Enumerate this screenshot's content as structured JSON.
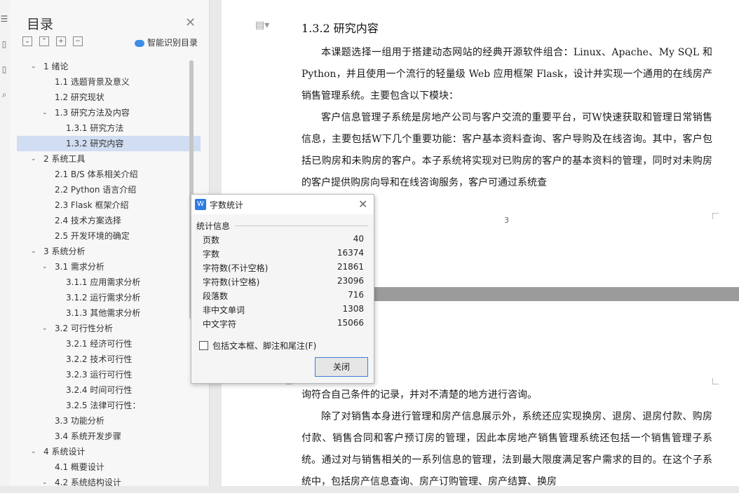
{
  "toc": {
    "title": "目录",
    "smart": "智能识别目录",
    "items": [
      {
        "label": "1 绪论",
        "level": 1,
        "arrow": "v"
      },
      {
        "label": "1.1 选题背景及意义",
        "level": 2
      },
      {
        "label": "1.2 研究现状",
        "level": 2
      },
      {
        "label": "1.3 研究方法及内容",
        "level": 2,
        "arrow": "v"
      },
      {
        "label": "1.3.1 研究方法",
        "level": 3
      },
      {
        "label": "1.3.2 研究内容",
        "level": 3,
        "active": true
      },
      {
        "label": "2 系统工具",
        "level": 1,
        "arrow": "v"
      },
      {
        "label": "2.1 B/S 体系相关介绍",
        "level": 2
      },
      {
        "label": "2.2 Python 语言介绍",
        "level": 2
      },
      {
        "label": "2.3 Flask 框架介绍",
        "level": 2
      },
      {
        "label": "2.4 技术方案选择",
        "level": 2
      },
      {
        "label": "2.5 开发环境的确定",
        "level": 2
      },
      {
        "label": "3 系统分析",
        "level": 1,
        "arrow": "v"
      },
      {
        "label": "3.1 需求分析",
        "level": 2,
        "arrow": "v"
      },
      {
        "label": "3.1.1 应用需求分析",
        "level": 3
      },
      {
        "label": "3.1.2 运行需求分析",
        "level": 3
      },
      {
        "label": "3.1.3 其他需求分析",
        "level": 3
      },
      {
        "label": "3.2 可行性分析",
        "level": 2,
        "arrow": "v"
      },
      {
        "label": "3.2.1 经济可行性",
        "level": 3
      },
      {
        "label": "3.2.2 技术可行性",
        "level": 3
      },
      {
        "label": "3.2.3 运行可行性",
        "level": 3
      },
      {
        "label": "3.2.4 时间可行性",
        "level": 3
      },
      {
        "label": "3.2.5 法律可行性：",
        "level": 3
      },
      {
        "label": "3.3 功能分析",
        "level": 2
      },
      {
        "label": "3.4 系统开发步骤",
        "level": 2
      },
      {
        "label": "4 系统设计",
        "level": 1,
        "arrow": "v"
      },
      {
        "label": "4.1 概要设计",
        "level": 2
      },
      {
        "label": "4.2 系统结构设计",
        "level": 2,
        "arrow": "v"
      }
    ]
  },
  "doc": {
    "heading": "1.3.2 研究内容",
    "p1": "本课题选择一组用于搭建动态网站的经典开源软件组合：Linux、Apache、My SQL 和 Python，并且使用一个流行的轻量级 Web 应用框架 Flask，设计并实现一个通用的在线房产销售管理系统。主要包含以下模块：",
    "p2": "客户信息管理子系统是房地产公司与客户交流的重要平台，可W快速获取和管理日常销售信息，主要包括W下几个重要功能：客户基本资料查询、客户导购及在线咨询。其中，客户包括已购房和未购房的客户。本子系统将实现对已购房的客户的基本资料的管理，同时对未购房的客户提供购房向导和在线咨询服务，客户可通过系统查",
    "page_number": "3",
    "p3": "询符合自己条件的记录，并对不清楚的地方进行咨询。",
    "p4": "除了对销售本身进行管理和房产信息展示外，系统还应实现换房、退房、退房付款、购房付款、销售合同和客户预订房的管理，因此本房地产销售管理系统还包括一个销售管理子系统。通过对与销售相关的一系列信息的管理，法到最大限度满足客户需求的目的。在这个子系统中，包括房产信息查询、房产订购管理、房产结算、换房"
  },
  "dialog": {
    "title": "字数统计",
    "section": "统计信息",
    "stats": [
      {
        "label": "页数",
        "value": "40"
      },
      {
        "label": "字数",
        "value": "16374"
      },
      {
        "label": "字符数(不计空格)",
        "value": "21861"
      },
      {
        "label": "字符数(计空格)",
        "value": "23096"
      },
      {
        "label": "段落数",
        "value": "716"
      },
      {
        "label": "非中文单词",
        "value": "1308"
      },
      {
        "label": "中文字符",
        "value": "15066"
      }
    ],
    "checkbox": "包括文本框、脚注和尾注(F)",
    "close": "关闭"
  }
}
